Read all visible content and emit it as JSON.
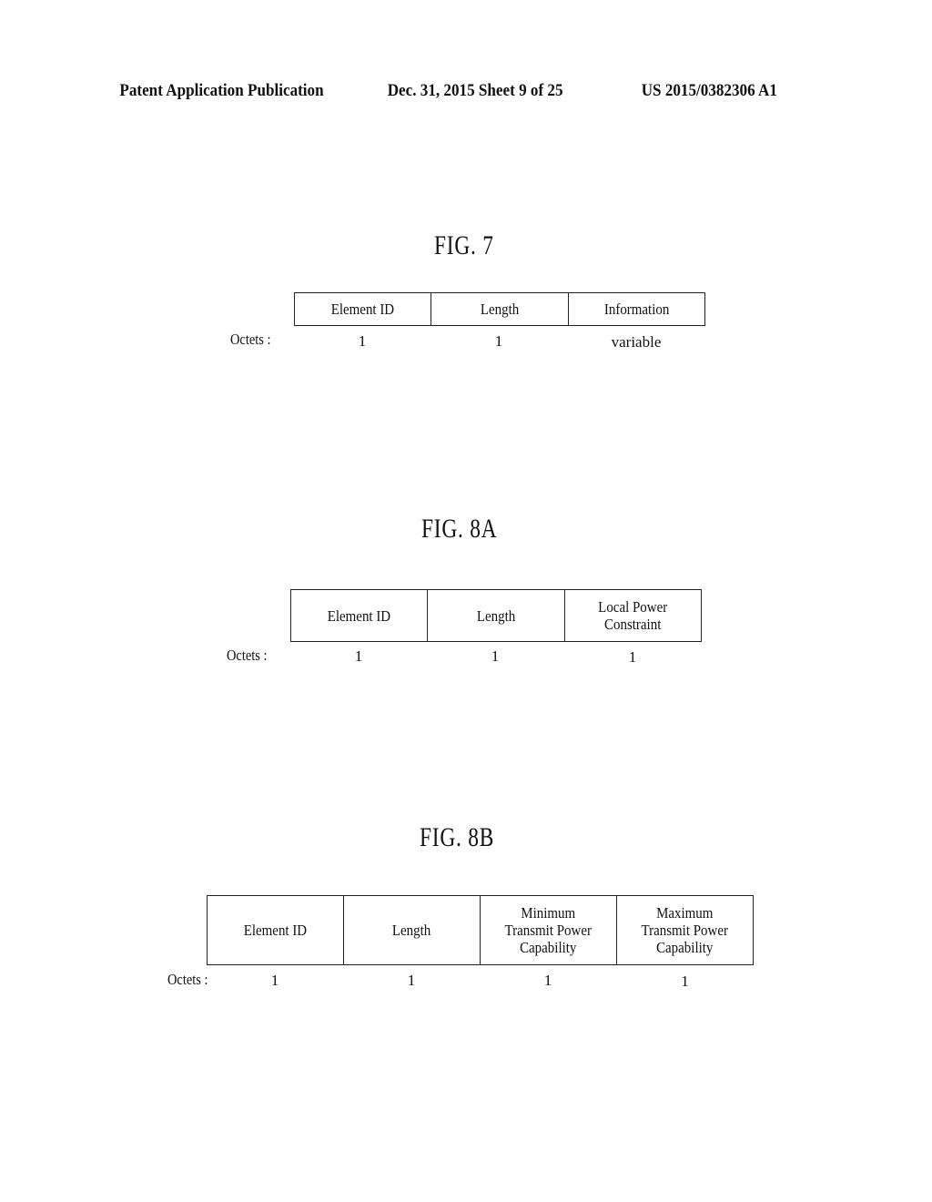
{
  "header": {
    "publication": "Patent Application Publication",
    "date_sheet": "Dec. 31, 2015   Sheet 9 of 25",
    "patent_number": "US 2015/0382306 A1"
  },
  "figures": [
    {
      "title": "FIG. 7",
      "octets_label": "Octets :",
      "fields": [
        {
          "name": "Element ID",
          "octets": "1"
        },
        {
          "name": "Length",
          "octets": "1"
        },
        {
          "name": "Information",
          "octets": "variable"
        }
      ]
    },
    {
      "title": "FIG. 8A",
      "octets_label": "Octets :",
      "fields": [
        {
          "name": "Element ID",
          "octets": "1"
        },
        {
          "name": "Length",
          "octets": "1"
        },
        {
          "name": "Local Power\nConstraint",
          "octets": "1"
        }
      ]
    },
    {
      "title": "FIG. 8B",
      "octets_label": "Octets :",
      "fields": [
        {
          "name": "Element ID",
          "octets": "1"
        },
        {
          "name": "Length",
          "octets": "1"
        },
        {
          "name": "Minimum\nTransmit Power\nCapability",
          "octets": "1"
        },
        {
          "name": "Maximum\nTransmit Power\nCapability",
          "octets": "1"
        }
      ]
    }
  ]
}
